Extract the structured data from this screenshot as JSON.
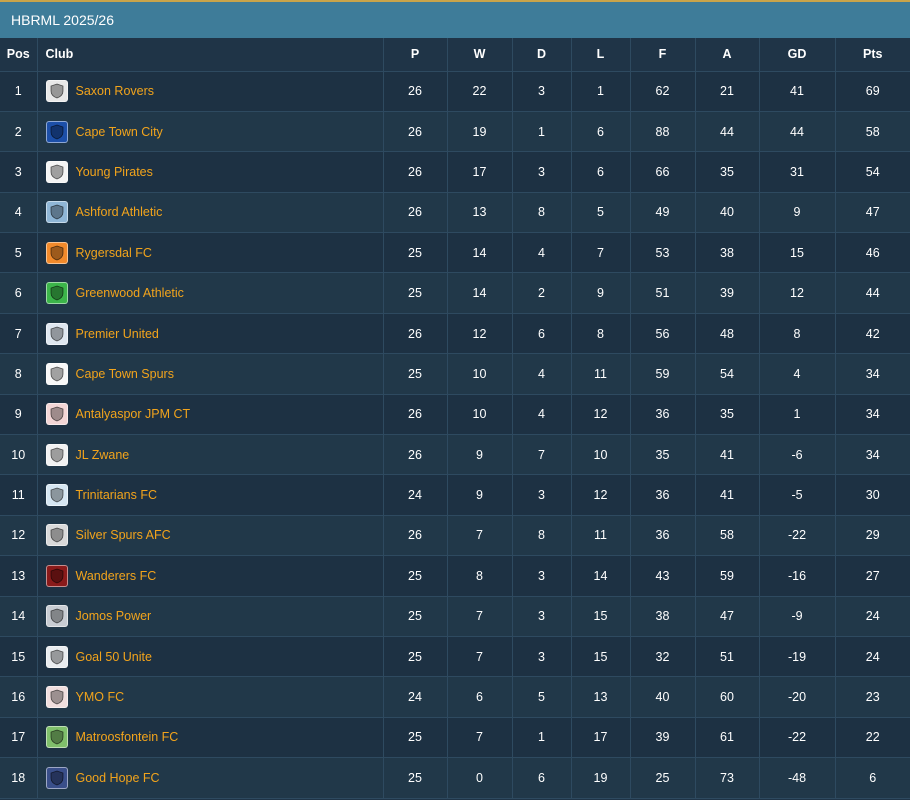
{
  "header": {
    "title": "HBRML 2025/26"
  },
  "columns": {
    "pos": "Pos",
    "club": "Club",
    "p": "P",
    "w": "W",
    "d": "D",
    "l": "L",
    "f": "F",
    "a": "A",
    "gd": "GD",
    "pts": "Pts"
  },
  "rows": [
    {
      "pos": "1",
      "club": "Saxon Rovers",
      "crest_icon": "saxon-rovers-crest-icon",
      "crest_color": "#e8e8e8",
      "p": "26",
      "w": "22",
      "d": "3",
      "l": "1",
      "f": "62",
      "a": "21",
      "gd": "41",
      "pts": "69"
    },
    {
      "pos": "2",
      "club": "Cape Town City",
      "crest_icon": "cape-town-city-crest-icon",
      "crest_color": "#1c4fa8",
      "p": "26",
      "w": "19",
      "d": "1",
      "l": "6",
      "f": "88",
      "a": "44",
      "gd": "44",
      "pts": "58"
    },
    {
      "pos": "3",
      "club": "Young Pirates",
      "crest_icon": "young-pirates-crest-icon",
      "crest_color": "#f4f4f4",
      "p": "26",
      "w": "17",
      "d": "3",
      "l": "6",
      "f": "66",
      "a": "35",
      "gd": "31",
      "pts": "54"
    },
    {
      "pos": "4",
      "club": "Ashford Athletic",
      "crest_icon": "ashford-athletic-crest-icon",
      "crest_color": "#8fb6d6",
      "p": "26",
      "w": "13",
      "d": "8",
      "l": "5",
      "f": "49",
      "a": "40",
      "gd": "9",
      "pts": "47"
    },
    {
      "pos": "5",
      "club": "Rygersdal FC",
      "crest_icon": "rygersdal-fc-crest-icon",
      "crest_color": "#f28a2b",
      "p": "25",
      "w": "14",
      "d": "4",
      "l": "7",
      "f": "53",
      "a": "38",
      "gd": "15",
      "pts": "46"
    },
    {
      "pos": "6",
      "club": "Greenwood Athletic",
      "crest_icon": "greenwood-athletic-crest-icon",
      "crest_color": "#3cb54a",
      "p": "25",
      "w": "14",
      "d": "2",
      "l": "9",
      "f": "51",
      "a": "39",
      "gd": "12",
      "pts": "44"
    },
    {
      "pos": "7",
      "club": "Premier United",
      "crest_icon": "premier-united-crest-icon",
      "crest_color": "#dfe7f0",
      "p": "26",
      "w": "12",
      "d": "6",
      "l": "8",
      "f": "56",
      "a": "48",
      "gd": "8",
      "pts": "42"
    },
    {
      "pos": "8",
      "club": "Cape Town Spurs",
      "crest_icon": "cape-town-spurs-crest-icon",
      "crest_color": "#f8f8f8",
      "p": "25",
      "w": "10",
      "d": "4",
      "l": "11",
      "f": "59",
      "a": "54",
      "gd": "4",
      "pts": "34"
    },
    {
      "pos": "9",
      "club": "Antalyaspor JPM CT",
      "crest_icon": "antalyaspor-crest-icon",
      "crest_color": "#f3d6d6",
      "p": "26",
      "w": "10",
      "d": "4",
      "l": "12",
      "f": "36",
      "a": "35",
      "gd": "1",
      "pts": "34"
    },
    {
      "pos": "10",
      "club": "JL Zwane",
      "crest_icon": "jl-zwane-crest-icon",
      "crest_color": "#f2f2f2",
      "p": "26",
      "w": "9",
      "d": "7",
      "l": "10",
      "f": "35",
      "a": "41",
      "gd": "-6",
      "pts": "34"
    },
    {
      "pos": "11",
      "club": "Trinitarians FC",
      "crest_icon": "trinitarians-fc-crest-icon",
      "crest_color": "#d6e6f2",
      "p": "24",
      "w": "9",
      "d": "3",
      "l": "12",
      "f": "36",
      "a": "41",
      "gd": "-5",
      "pts": "30"
    },
    {
      "pos": "12",
      "club": "Silver Spurs AFC",
      "crest_icon": "silver-spurs-afc-crest-icon",
      "crest_color": "#d9d9d9",
      "p": "26",
      "w": "7",
      "d": "8",
      "l": "11",
      "f": "36",
      "a": "58",
      "gd": "-22",
      "pts": "29"
    },
    {
      "pos": "13",
      "club": "Wanderers FC",
      "crest_icon": "wanderers-fc-crest-icon",
      "crest_color": "#8a1a1a",
      "p": "25",
      "w": "8",
      "d": "3",
      "l": "14",
      "f": "43",
      "a": "59",
      "gd": "-16",
      "pts": "27"
    },
    {
      "pos": "14",
      "club": "Jomos Power",
      "crest_icon": "jomos-power-crest-icon",
      "crest_color": "#c8ccd2",
      "p": "25",
      "w": "7",
      "d": "3",
      "l": "15",
      "f": "38",
      "a": "47",
      "gd": "-9",
      "pts": "24"
    },
    {
      "pos": "15",
      "club": "Goal 50 Unite",
      "crest_icon": "goal-50-unite-crest-icon",
      "crest_color": "#e9ecef",
      "p": "25",
      "w": "7",
      "d": "3",
      "l": "15",
      "f": "32",
      "a": "51",
      "gd": "-19",
      "pts": "24"
    },
    {
      "pos": "16",
      "club": "YMO FC",
      "crest_icon": "ymo-fc-crest-icon",
      "crest_color": "#f0dede",
      "p": "24",
      "w": "6",
      "d": "5",
      "l": "13",
      "f": "40",
      "a": "60",
      "gd": "-20",
      "pts": "23"
    },
    {
      "pos": "17",
      "club": "Matroosfontein FC",
      "crest_icon": "matroosfontein-fc-crest-icon",
      "crest_color": "#7fbf6b",
      "p": "25",
      "w": "7",
      "d": "1",
      "l": "17",
      "f": "39",
      "a": "61",
      "gd": "-22",
      "pts": "22"
    },
    {
      "pos": "18",
      "club": "Good Hope FC",
      "crest_icon": "good-hope-fc-crest-icon",
      "crest_color": "#3a4f8a",
      "p": "25",
      "w": "0",
      "d": "6",
      "l": "19",
      "f": "25",
      "a": "73",
      "gd": "-48",
      "pts": "6"
    }
  ],
  "colors": {
    "header_bar": "#3e7c99",
    "background": "#1f3447",
    "club_link": "#f2a41c",
    "accent_line": "#c9a44a"
  }
}
